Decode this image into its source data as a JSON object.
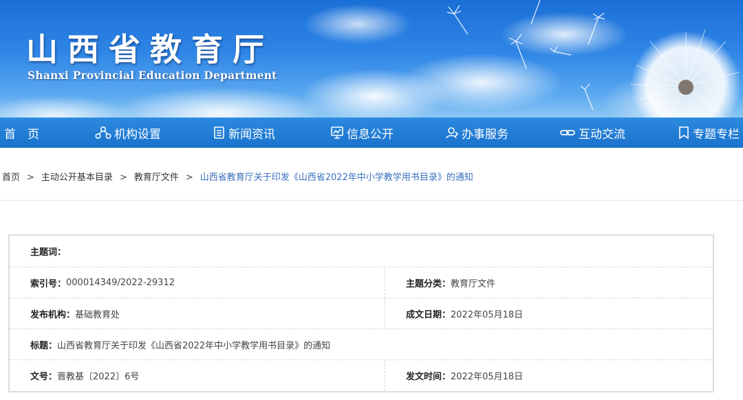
{
  "banner": {
    "title": "山西省教育厅",
    "subtitle": "Shanxi Provincial Education Department"
  },
  "nav": {
    "items": [
      {
        "label": "首　页",
        "icon": "home"
      },
      {
        "label": "机构设置",
        "icon": "org-chart-icon"
      },
      {
        "label": "新闻资讯",
        "icon": "document-icon"
      },
      {
        "label": "信息公开",
        "icon": "chart-board-icon"
      },
      {
        "label": "办事服务",
        "icon": "user-service-icon"
      },
      {
        "label": "互动交流",
        "icon": "link-chain-icon"
      },
      {
        "label": "专题专栏",
        "icon": "bookmark-icon"
      }
    ]
  },
  "breadcrumb": {
    "items": [
      "首页",
      "主动公开基本目录",
      "教育厅文件",
      "山西省教育厅关于印发《山西省2022年中小学教学用书目录》的通知"
    ],
    "separator": ">"
  },
  "meta": {
    "theme_words": {
      "label": "主题词：",
      "value": ""
    },
    "index_no": {
      "label": "索引号：",
      "value": "000014349/2022-29312"
    },
    "category": {
      "label": "主题分类：",
      "value": "教育厅文件"
    },
    "publisher": {
      "label": "发布机构：",
      "value": "基础教育处"
    },
    "created_date": {
      "label": "成文日期：",
      "value": "2022年05月18日"
    },
    "title": {
      "label": "标题：",
      "value": "山西省教育厅关于印发《山西省2022年中小学教学用书目录》的通知"
    },
    "doc_no": {
      "label": "文号：",
      "value": "晋教基〔2022〕6号"
    },
    "publish_time": {
      "label": "发文时间：",
      "value": "2022年05月18日"
    }
  },
  "colors": {
    "nav_bg": "#1a72cc",
    "breadcrumb_current": "#3a6fbf",
    "banner_sky": "#2f86e6"
  }
}
